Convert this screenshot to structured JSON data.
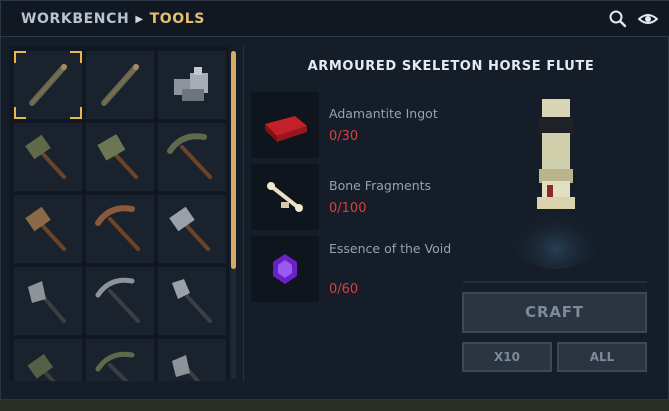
{
  "header": {
    "breadcrumb_root": "WORKBENCH",
    "breadcrumb_current": "TOOLS",
    "icons": [
      "search-icon",
      "eye-icon"
    ]
  },
  "grid": {
    "items": [
      {
        "icon": "flute-icon",
        "selected": true
      },
      {
        "icon": "flute-icon"
      },
      {
        "icon": "ore-cluster-icon"
      },
      {
        "icon": "hammer-icon"
      },
      {
        "icon": "hammer-icon"
      },
      {
        "icon": "pickaxe-icon"
      },
      {
        "icon": "hammer-icon"
      },
      {
        "icon": "pickaxe-icon"
      },
      {
        "icon": "hammer-icon"
      },
      {
        "icon": "axe-icon"
      },
      {
        "icon": "pickaxe-icon"
      },
      {
        "icon": "shovel-icon"
      },
      {
        "icon": "hammer-icon"
      },
      {
        "icon": "pickaxe-icon"
      },
      {
        "icon": "axe-icon"
      }
    ],
    "scroll_fraction_visible": 0.66
  },
  "detail": {
    "title": "ARMOURED SKELETON HORSE FLUTE",
    "materials": [
      {
        "name": "Adamantite Ingot",
        "count": "0/30",
        "icon": "ingot-icon"
      },
      {
        "name": "Bone Fragments",
        "count": "0/100",
        "icon": "bone-icon"
      },
      {
        "name": "Essence of the Void",
        "count": "0/60",
        "icon": "void-essence-icon"
      }
    ],
    "preview_icon": "flute-preview-icon",
    "buttons": {
      "craft": "CRAFT",
      "x10": "X10",
      "all": "ALL"
    }
  },
  "colors": {
    "accent": "#e5c06f",
    "missing_count": "#d7413c",
    "panel_bg": "#151d28"
  }
}
